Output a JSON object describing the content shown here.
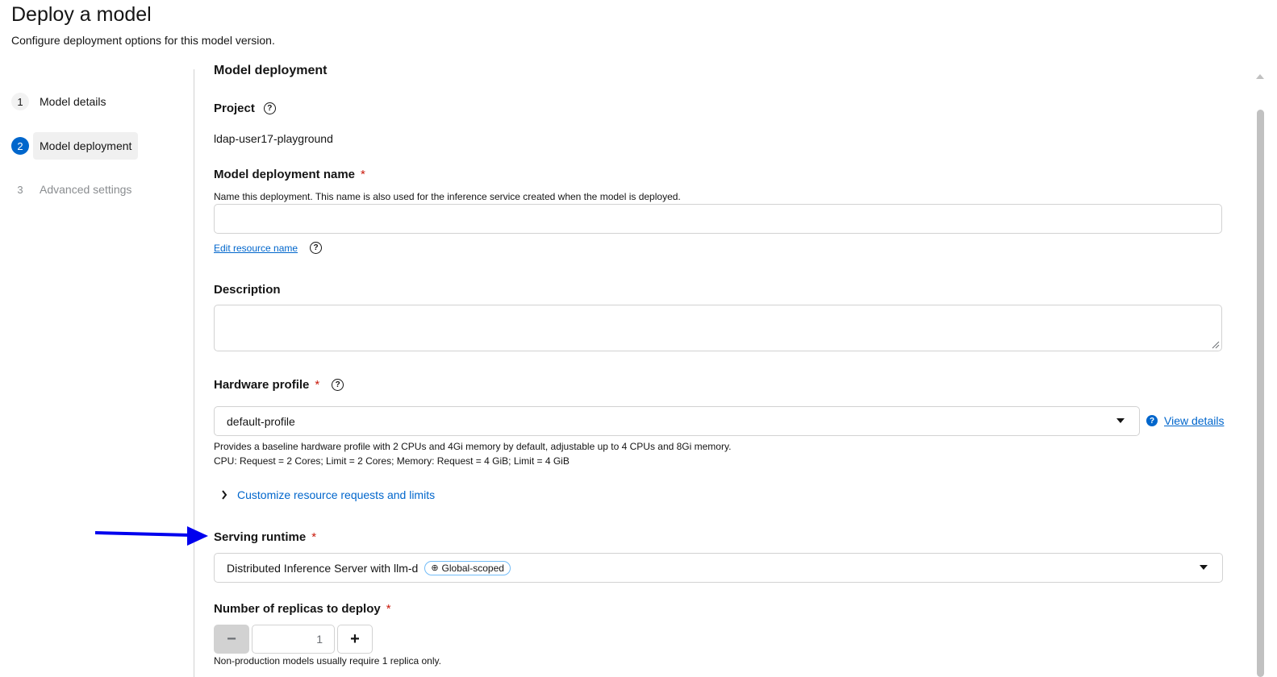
{
  "page": {
    "title": "Deploy a model",
    "subtitle": "Configure deployment options for this model version."
  },
  "wizard": {
    "steps": [
      {
        "num": "1",
        "label": "Model details",
        "state": "normal"
      },
      {
        "num": "2",
        "label": "Model deployment",
        "state": "current"
      },
      {
        "num": "3",
        "label": "Advanced settings",
        "state": "disabled"
      }
    ]
  },
  "form": {
    "section_title": "Model deployment",
    "project": {
      "label": "Project",
      "value": "ldap-user17-playground"
    },
    "deployment_name": {
      "label": "Model deployment name",
      "required": "*",
      "helper": "Name this deployment. This name is also used for the inference service created when the model is deployed.",
      "value": "",
      "edit_link": "Edit resource name"
    },
    "description": {
      "label": "Description",
      "value": ""
    },
    "hardware_profile": {
      "label": "Hardware profile",
      "required": "*",
      "selected": "default-profile",
      "view_details": "View details",
      "desc_line1": "Provides a baseline hardware profile with 2 CPUs and 4Gi memory by default, adjustable up to 4 CPUs and 8Gi memory.",
      "desc_line2": "CPU: Request = 2 Cores; Limit = 2 Cores; Memory: Request = 4 GiB; Limit = 4 GiB",
      "customize": "Customize resource requests and limits"
    },
    "serving_runtime": {
      "label": "Serving runtime",
      "required": "*",
      "selected": "Distributed Inference Server with llm-d",
      "badge": "Global-scoped"
    },
    "replicas": {
      "label": "Number of replicas to deploy",
      "required": "*",
      "value": "1",
      "minus": "−",
      "plus": "+",
      "helper": "Non-production models usually require 1 replica only."
    }
  },
  "colors": {
    "primary": "#0066cc",
    "required": "#c9190b",
    "annotation_arrow": "#0000ee"
  },
  "icons": [
    "help-icon",
    "chevron-right-icon",
    "caret-down-icon",
    "globe-icon",
    "question-circle-icon"
  ]
}
